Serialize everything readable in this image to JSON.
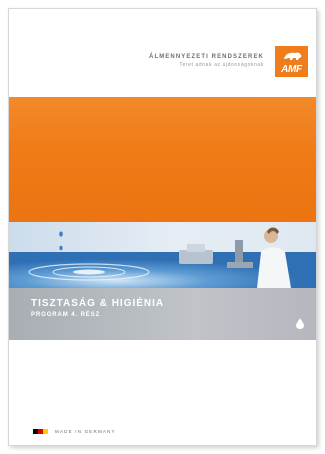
{
  "header": {
    "title": "ÁLMENNYEZETI RENDSZEREK",
    "subtitle": "Teret adnak az újdonságoknak"
  },
  "logo": {
    "text": "AMF",
    "color": "#ef7d1b"
  },
  "band": {
    "title": "TISZTASÁG & HIGIÉNIA",
    "subtitle": "PROGRAM 4. RÉSZ",
    "icon": "water-drop-icon"
  },
  "footer": {
    "made_in": "MADE IN GERMANY",
    "flag_colors": [
      "#000000",
      "#dd0000",
      "#ffce00"
    ]
  },
  "colors": {
    "accent": "#ef7d1b",
    "band_grey": "#b3b7bd"
  }
}
